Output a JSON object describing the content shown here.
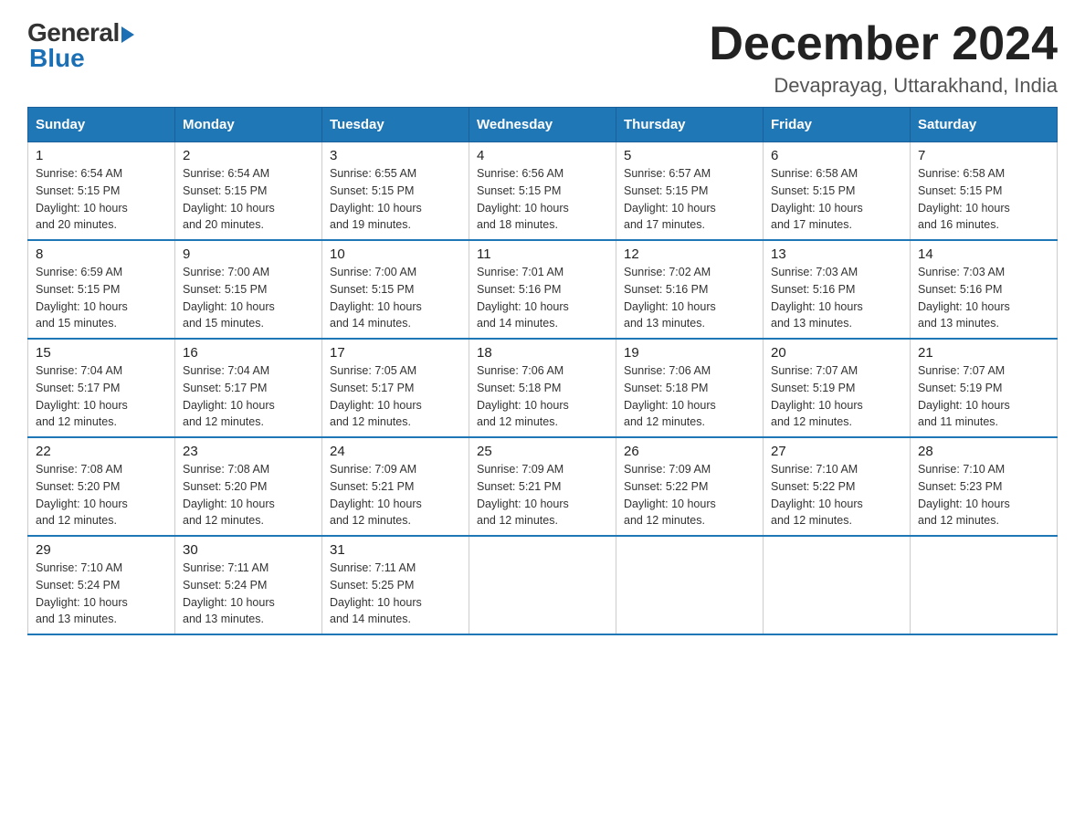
{
  "logo": {
    "general": "General",
    "blue": "Blue"
  },
  "title": {
    "month": "December 2024",
    "location": "Devaprayag, Uttarakhand, India"
  },
  "weekdays": [
    "Sunday",
    "Monday",
    "Tuesday",
    "Wednesday",
    "Thursday",
    "Friday",
    "Saturday"
  ],
  "weeks": [
    [
      {
        "day": "1",
        "sunrise": "6:54 AM",
        "sunset": "5:15 PM",
        "daylight": "10 hours and 20 minutes."
      },
      {
        "day": "2",
        "sunrise": "6:54 AM",
        "sunset": "5:15 PM",
        "daylight": "10 hours and 20 minutes."
      },
      {
        "day": "3",
        "sunrise": "6:55 AM",
        "sunset": "5:15 PM",
        "daylight": "10 hours and 19 minutes."
      },
      {
        "day": "4",
        "sunrise": "6:56 AM",
        "sunset": "5:15 PM",
        "daylight": "10 hours and 18 minutes."
      },
      {
        "day": "5",
        "sunrise": "6:57 AM",
        "sunset": "5:15 PM",
        "daylight": "10 hours and 17 minutes."
      },
      {
        "day": "6",
        "sunrise": "6:58 AM",
        "sunset": "5:15 PM",
        "daylight": "10 hours and 17 minutes."
      },
      {
        "day": "7",
        "sunrise": "6:58 AM",
        "sunset": "5:15 PM",
        "daylight": "10 hours and 16 minutes."
      }
    ],
    [
      {
        "day": "8",
        "sunrise": "6:59 AM",
        "sunset": "5:15 PM",
        "daylight": "10 hours and 15 minutes."
      },
      {
        "day": "9",
        "sunrise": "7:00 AM",
        "sunset": "5:15 PM",
        "daylight": "10 hours and 15 minutes."
      },
      {
        "day": "10",
        "sunrise": "7:00 AM",
        "sunset": "5:15 PM",
        "daylight": "10 hours and 14 minutes."
      },
      {
        "day": "11",
        "sunrise": "7:01 AM",
        "sunset": "5:16 PM",
        "daylight": "10 hours and 14 minutes."
      },
      {
        "day": "12",
        "sunrise": "7:02 AM",
        "sunset": "5:16 PM",
        "daylight": "10 hours and 13 minutes."
      },
      {
        "day": "13",
        "sunrise": "7:03 AM",
        "sunset": "5:16 PM",
        "daylight": "10 hours and 13 minutes."
      },
      {
        "day": "14",
        "sunrise": "7:03 AM",
        "sunset": "5:16 PM",
        "daylight": "10 hours and 13 minutes."
      }
    ],
    [
      {
        "day": "15",
        "sunrise": "7:04 AM",
        "sunset": "5:17 PM",
        "daylight": "10 hours and 12 minutes."
      },
      {
        "day": "16",
        "sunrise": "7:04 AM",
        "sunset": "5:17 PM",
        "daylight": "10 hours and 12 minutes."
      },
      {
        "day": "17",
        "sunrise": "7:05 AM",
        "sunset": "5:17 PM",
        "daylight": "10 hours and 12 minutes."
      },
      {
        "day": "18",
        "sunrise": "7:06 AM",
        "sunset": "5:18 PM",
        "daylight": "10 hours and 12 minutes."
      },
      {
        "day": "19",
        "sunrise": "7:06 AM",
        "sunset": "5:18 PM",
        "daylight": "10 hours and 12 minutes."
      },
      {
        "day": "20",
        "sunrise": "7:07 AM",
        "sunset": "5:19 PM",
        "daylight": "10 hours and 12 minutes."
      },
      {
        "day": "21",
        "sunrise": "7:07 AM",
        "sunset": "5:19 PM",
        "daylight": "10 hours and 11 minutes."
      }
    ],
    [
      {
        "day": "22",
        "sunrise": "7:08 AM",
        "sunset": "5:20 PM",
        "daylight": "10 hours and 12 minutes."
      },
      {
        "day": "23",
        "sunrise": "7:08 AM",
        "sunset": "5:20 PM",
        "daylight": "10 hours and 12 minutes."
      },
      {
        "day": "24",
        "sunrise": "7:09 AM",
        "sunset": "5:21 PM",
        "daylight": "10 hours and 12 minutes."
      },
      {
        "day": "25",
        "sunrise": "7:09 AM",
        "sunset": "5:21 PM",
        "daylight": "10 hours and 12 minutes."
      },
      {
        "day": "26",
        "sunrise": "7:09 AM",
        "sunset": "5:22 PM",
        "daylight": "10 hours and 12 minutes."
      },
      {
        "day": "27",
        "sunrise": "7:10 AM",
        "sunset": "5:22 PM",
        "daylight": "10 hours and 12 minutes."
      },
      {
        "day": "28",
        "sunrise": "7:10 AM",
        "sunset": "5:23 PM",
        "daylight": "10 hours and 12 minutes."
      }
    ],
    [
      {
        "day": "29",
        "sunrise": "7:10 AM",
        "sunset": "5:24 PM",
        "daylight": "10 hours and 13 minutes."
      },
      {
        "day": "30",
        "sunrise": "7:11 AM",
        "sunset": "5:24 PM",
        "daylight": "10 hours and 13 minutes."
      },
      {
        "day": "31",
        "sunrise": "7:11 AM",
        "sunset": "5:25 PM",
        "daylight": "10 hours and 14 minutes."
      },
      null,
      null,
      null,
      null
    ]
  ],
  "labels": {
    "sunrise": "Sunrise:",
    "sunset": "Sunset:",
    "daylight": "Daylight:"
  }
}
